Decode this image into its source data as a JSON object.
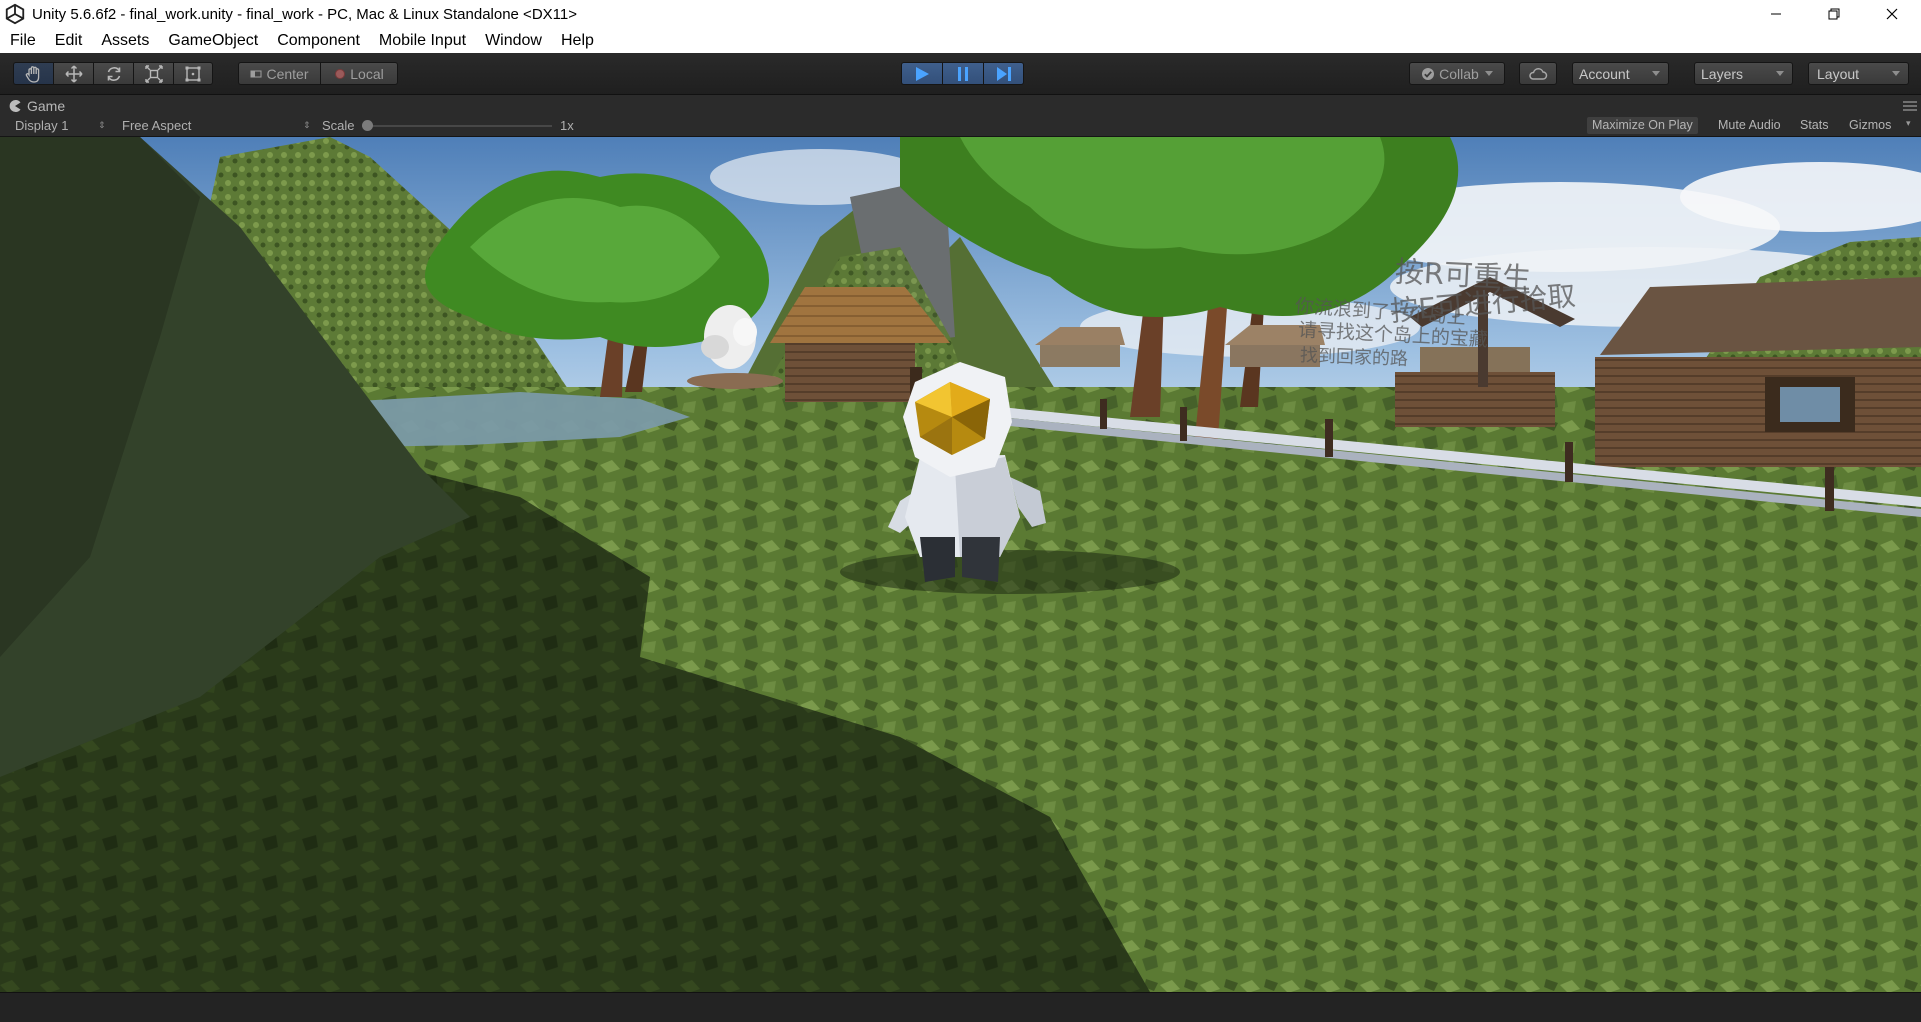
{
  "window": {
    "title": "Unity 5.6.6f2 - final_work.unity - final_work - PC, Mac & Linux Standalone <DX11>"
  },
  "menu": [
    "File",
    "Edit",
    "Assets",
    "GameObject",
    "Component",
    "Mobile Input",
    "Window",
    "Help"
  ],
  "toolbar": {
    "pivot_center": "Center",
    "pivot_local": "Local",
    "collab": "Collab",
    "account": "Account",
    "layers": "Layers",
    "layout": "Layout"
  },
  "game_tab": {
    "label": "Game",
    "display": "Display 1",
    "aspect": "Free Aspect",
    "scale_label": "Scale",
    "scale_value": "1x",
    "scale_fraction": 0.0,
    "maximize_on_play": "Maximize On Play",
    "mute_audio": "Mute Audio",
    "stats": "Stats",
    "gizmos": "Gizmos"
  },
  "game_overlay": {
    "line1": "按R可重生",
    "line2": "按E可进行拾取",
    "line3": "你流浪到了一个岛上",
    "line4": "请寻找这个岛上的宝藏",
    "line5": "找到回家的路"
  },
  "colors": {
    "play_active": "#3a5a86",
    "play_icon": "#4aa3ff"
  }
}
